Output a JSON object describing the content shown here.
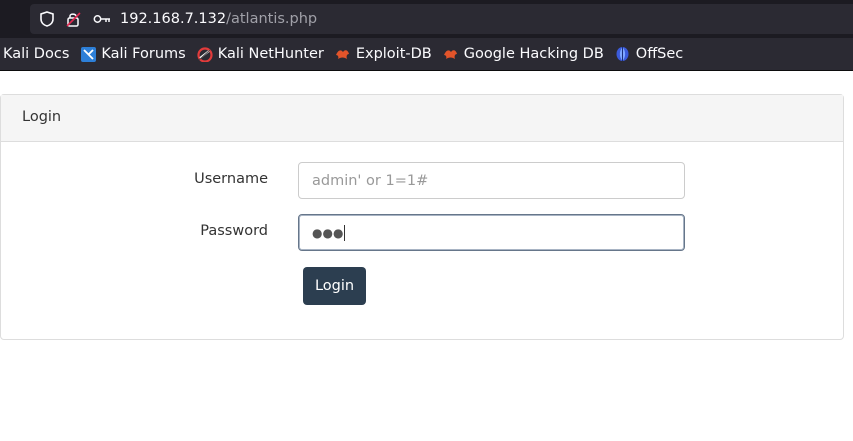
{
  "browser": {
    "url_host": "192.168.7.132",
    "url_path": "/atlantis.php",
    "bookmarks": [
      {
        "label": "Kali Docs",
        "icon": "kali-docs-icon"
      },
      {
        "label": "Kali Forums",
        "icon": "kali-forums-icon"
      },
      {
        "label": "Kali NetHunter",
        "icon": "kali-nethunter-icon"
      },
      {
        "label": "Exploit-DB",
        "icon": "exploit-db-icon"
      },
      {
        "label": "Google Hacking DB",
        "icon": "google-hacking-db-icon"
      },
      {
        "label": "OffSec",
        "icon": "offsec-icon"
      }
    ]
  },
  "panel": {
    "heading": "Login"
  },
  "form": {
    "username_label": "Username",
    "username_placeholder": "admin' or 1=1#",
    "password_label": "Password",
    "password_mask": "●●●",
    "submit_label": "Login"
  },
  "colors": {
    "chrome_bg": "#1c1b22",
    "bar_bg": "#2b2a33",
    "button_bg": "#2c3e50",
    "exploit_db_accent": "#e2542a"
  }
}
